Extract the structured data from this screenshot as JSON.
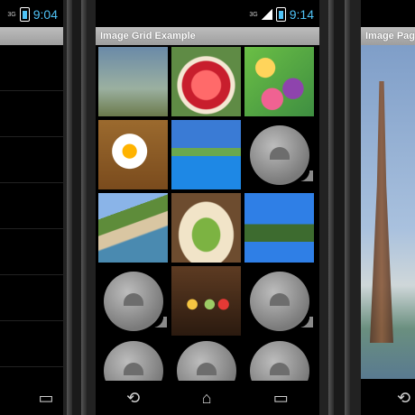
{
  "left_phone": {
    "status": {
      "network": "3G",
      "time": "9:04"
    }
  },
  "center_phone": {
    "status": {
      "network": "3G",
      "time": "9:14"
    },
    "title": "Image Grid Example",
    "grid_items": [
      {
        "kind": "photo",
        "subject": "fountain-sculpture"
      },
      {
        "kind": "photo",
        "subject": "flower-bed"
      },
      {
        "kind": "photo",
        "subject": "flower-market"
      },
      {
        "kind": "photo",
        "subject": "fried-egg"
      },
      {
        "kind": "photo",
        "subject": "resort-pool"
      },
      {
        "kind": "placeholder",
        "subject": "android-placeholder"
      },
      {
        "kind": "photo",
        "subject": "coastline"
      },
      {
        "kind": "photo",
        "subject": "android-cake"
      },
      {
        "kind": "photo",
        "subject": "lighthouse-cliff"
      },
      {
        "kind": "placeholder",
        "subject": "android-placeholder"
      },
      {
        "kind": "photo",
        "subject": "android-figures"
      },
      {
        "kind": "placeholder",
        "subject": "android-placeholder"
      },
      {
        "kind": "placeholder",
        "subject": "android-placeholder"
      },
      {
        "kind": "placeholder",
        "subject": "android-placeholder"
      },
      {
        "kind": "placeholder",
        "subject": "android-placeholder"
      }
    ]
  },
  "right_phone": {
    "title": "Image Page",
    "image_subject": "eiffel-tower"
  },
  "colors": {
    "accent_time": "#4fc3f7",
    "titlebar": "#a8a8a8"
  },
  "nav_icons": [
    "back-icon",
    "home-icon",
    "recent-apps-icon"
  ]
}
